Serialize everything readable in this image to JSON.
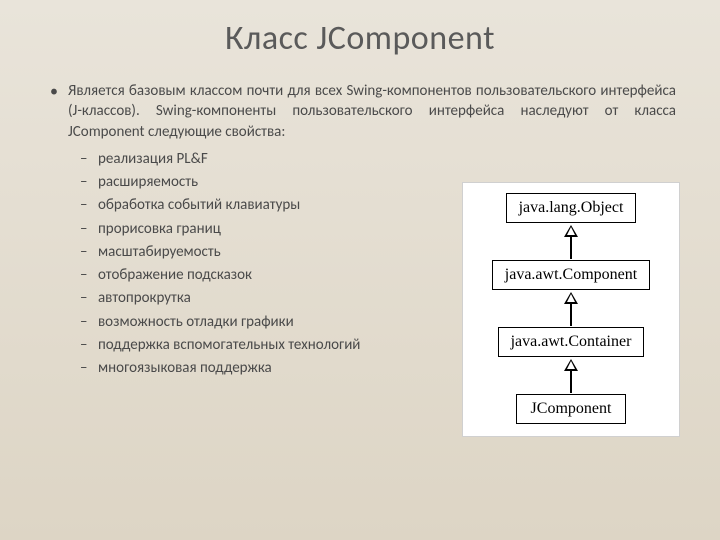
{
  "title": "Класс JComponent",
  "intro": "Является базовым классом почти для всех Swing-компонентов пользовательского интерфейса (J-классов). Swing-компоненты пользовательского интерфейса наследуют от класса JComponent следующие свойства:",
  "properties": [
    "реализация PL&F",
    "расширяемость",
    "обработка событий клавиатуры",
    "прорисовка границ",
    "масштабируемость",
    "отображение подсказок",
    "автопрокрутка",
    "возможность отладки графики",
    "поддержка вспомогательных технологий",
    "многоязыковая поддержка"
  ],
  "hierarchy": [
    "java.lang.Object",
    "java.awt.Component",
    "java.awt.Container",
    "JComponent"
  ]
}
